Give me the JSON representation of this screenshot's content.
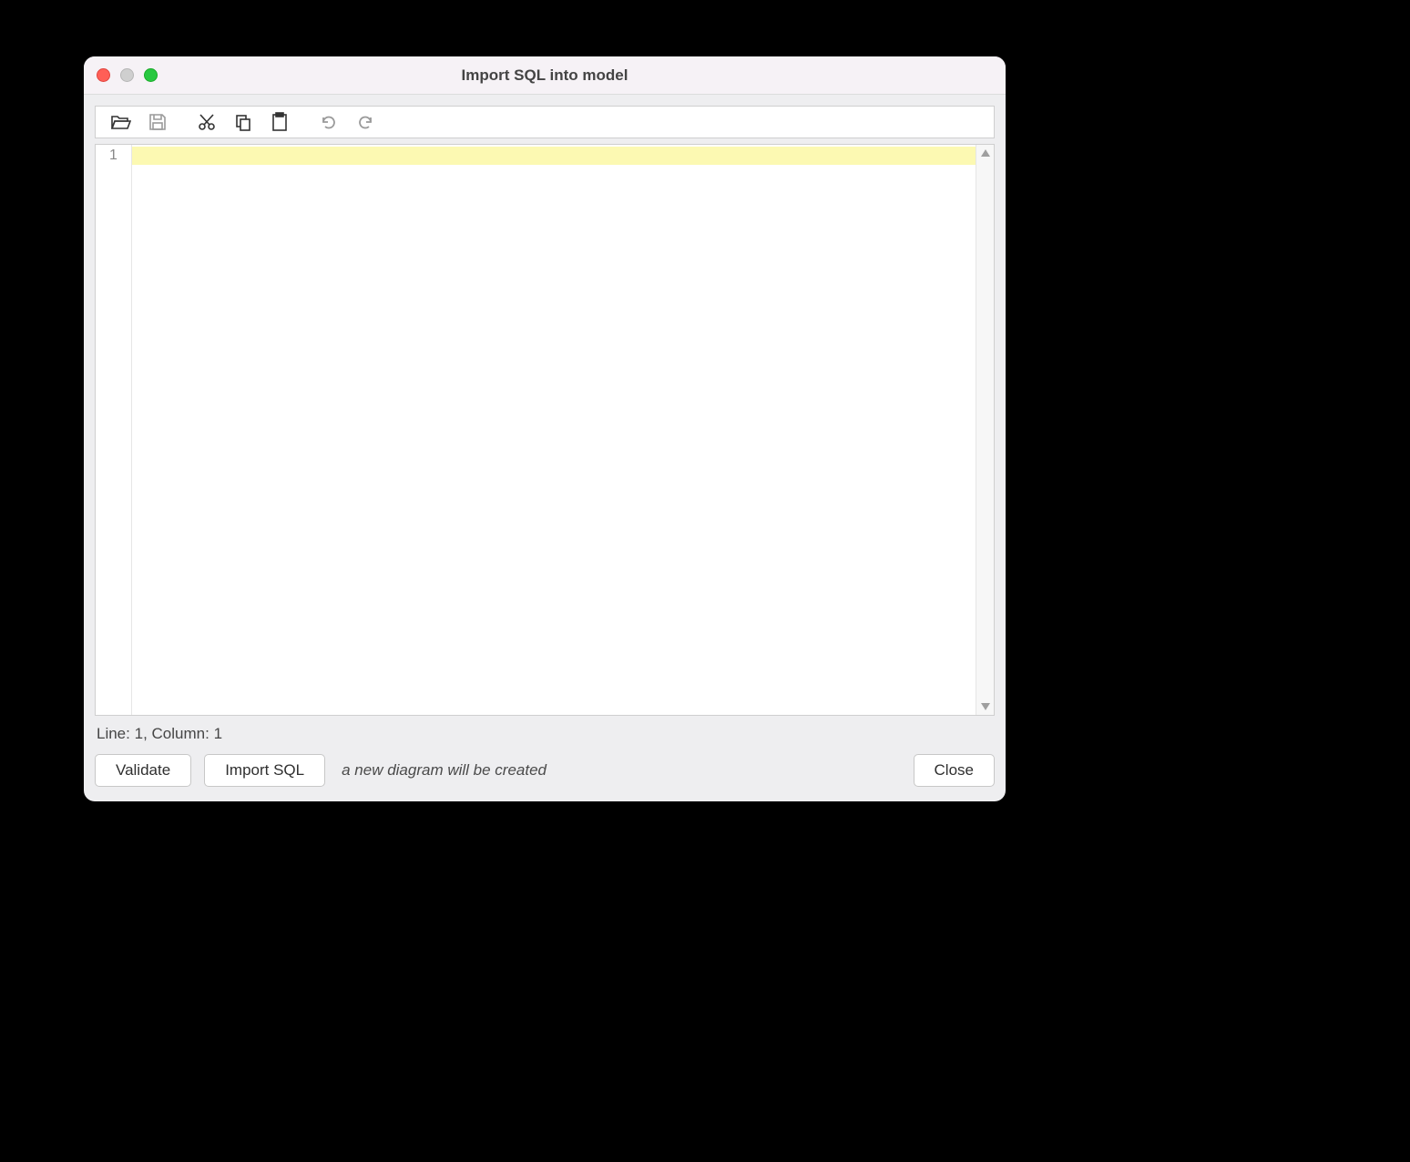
{
  "window": {
    "title": "Import SQL into model"
  },
  "toolbar": {
    "open_icon": "open-icon",
    "save_icon": "save-icon",
    "cut_icon": "cut-icon",
    "copy_icon": "copy-icon",
    "paste_icon": "paste-icon",
    "undo_icon": "undo-icon",
    "redo_icon": "redo-icon"
  },
  "editor": {
    "line_numbers": [
      "1"
    ],
    "content": ""
  },
  "status": {
    "line_label": "Line:",
    "line": "1",
    "column_label": "Column:",
    "column": "1"
  },
  "footer": {
    "validate_label": "Validate",
    "import_label": "Import SQL",
    "hint": "a new diagram will be created",
    "close_label": "Close"
  }
}
